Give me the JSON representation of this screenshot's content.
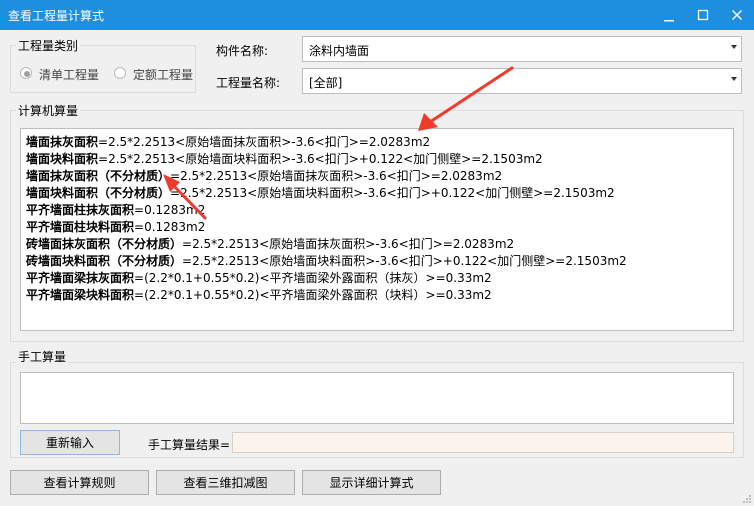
{
  "window": {
    "title": "查看工程量计算式"
  },
  "quantity_type": {
    "group_title": "工程量类别",
    "options": [
      {
        "label": "清单工程量",
        "checked": true
      },
      {
        "label": "定额工程量",
        "checked": false
      }
    ]
  },
  "component_name": {
    "label": "构件名称:",
    "value": "涂料内墙面"
  },
  "quantity_name": {
    "label": "工程量名称:",
    "value": "[全部]"
  },
  "computer_calc": {
    "group_title": "计算机算量",
    "lines": [
      {
        "name": "墙面抹灰面积",
        "formula": "=2.5*2.2513<原始墙面抹灰面积>-3.6<扣门>=2.0283m2"
      },
      {
        "name": "墙面块料面积",
        "formula": "=2.5*2.2513<原始墙面块料面积>-3.6<扣门>+0.122<加门侧壁>=2.1503m2"
      },
      {
        "name": "墙面抹灰面积（不分材质）",
        "formula": "=2.5*2.2513<原始墙面抹灰面积>-3.6<扣门>=2.0283m2"
      },
      {
        "name": "墙面块料面积（不分材质）",
        "formula": "=2.5*2.2513<原始墙面块料面积>-3.6<扣门>+0.122<加门侧壁>=2.1503m2"
      },
      {
        "name": "平齐墙面柱抹灰面积",
        "formula": "=0.1283m2"
      },
      {
        "name": "平齐墙面柱块料面积",
        "formula": "=0.1283m2"
      },
      {
        "name": "砖墙面抹灰面积（不分材质）",
        "formula": "=2.5*2.2513<原始墙面抹灰面积>-3.6<扣门>=2.0283m2"
      },
      {
        "name": "砖墙面块料面积（不分材质）",
        "formula": "=2.5*2.2513<原始墙面块料面积>-3.6<扣门>+0.122<加门侧壁>=2.1503m2"
      },
      {
        "name": "平齐墙面梁抹灰面积",
        "formula": "=(2.2*0.1+0.55*0.2)<平齐墙面梁外露面积（抹灰）>=0.33m2"
      },
      {
        "name": "平齐墙面梁块料面积",
        "formula": "=(2.2*0.1+0.55*0.2)<平齐墙面梁外露面积（块料）>=0.33m2"
      }
    ]
  },
  "manual_calc": {
    "group_title": "手工算量",
    "input_value": "",
    "reinput_button": "重新输入",
    "result_label": "手工算量结果=",
    "result_value": ""
  },
  "bottom_buttons": {
    "rules": "查看计算规则",
    "view3d": "查看三维扣减图",
    "detail": "显示详细计算式"
  },
  "colors": {
    "titlebar": "#1e8fde",
    "annotation_arrow": "#f03a2c",
    "result_field": "#fbf3ec"
  },
  "icons": [
    "minimize-icon",
    "maximize-icon",
    "close-icon",
    "radio-icon",
    "chevron-down-icon",
    "annotation-arrow-icon",
    "resize-grip-icon"
  ]
}
